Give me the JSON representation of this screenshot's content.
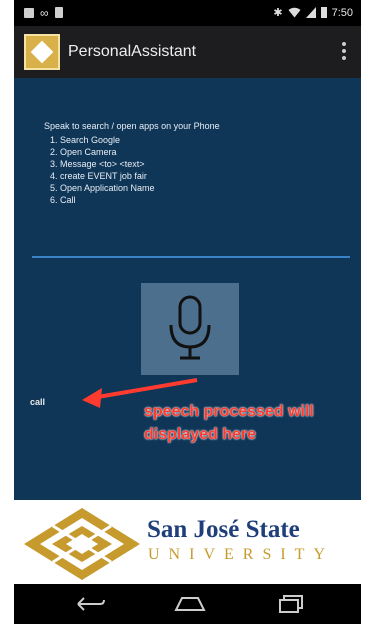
{
  "status_bar": {
    "time": "7:50",
    "left_icons": [
      "image-icon",
      "voicemail-icon",
      "notification-icon"
    ],
    "right_icons": [
      "bluetooth-icon",
      "wifi-icon",
      "signal-icon",
      "battery-icon"
    ]
  },
  "action_bar": {
    "title": "PersonalAssistant",
    "logo_icon": "sjsu-logo-icon",
    "menu_icon": "overflow-menu-icon"
  },
  "instructions": {
    "intro": "Speak to search / open apps on your Phone",
    "items": [
      "1. Search Google",
      "2. Open Camera",
      "3. Message <to> <text>",
      "4. create EVENT job fair",
      "5. Open Application Name",
      "6. Call"
    ]
  },
  "mic": {
    "icon": "microphone-icon"
  },
  "result": {
    "text": "call"
  },
  "annotation": {
    "line1": "speech processed will",
    "line2": "displayed here",
    "color": "#ff3b2f"
  },
  "footer": {
    "name": "San José State",
    "university": "UNIVERSITY",
    "name_color": "#1f3f7a",
    "gold_color": "#c79a2e"
  },
  "nav_bar": {
    "icons": [
      "back-icon",
      "home-icon",
      "recent-apps-icon"
    ]
  },
  "colors": {
    "content_bg": "#0f3557",
    "action_bar_bg": "#1d1d1f",
    "accent_line": "#3a82c8"
  }
}
